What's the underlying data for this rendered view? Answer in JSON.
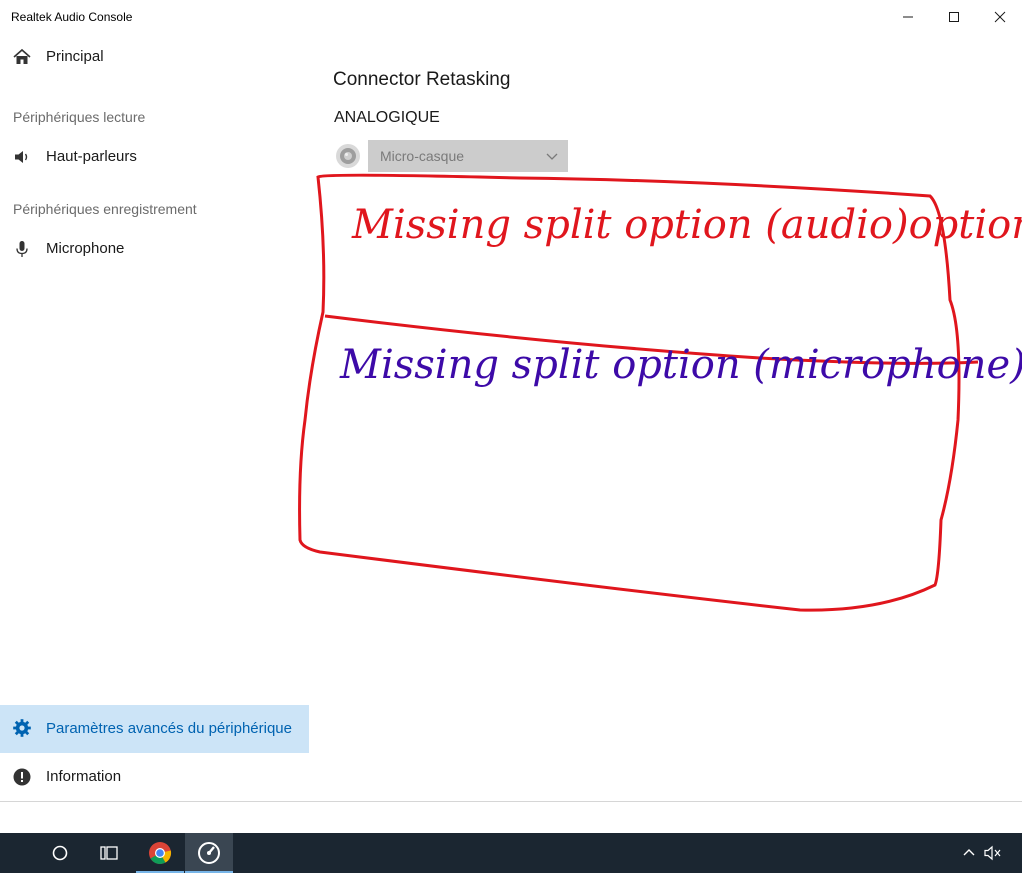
{
  "window": {
    "title": "Realtek Audio Console",
    "controls": [
      "minimize",
      "maximize",
      "close"
    ]
  },
  "sidebar": {
    "main_item": {
      "label": "Principal",
      "icon": "home-icon"
    },
    "playback_header": "Périphériques lecture",
    "playback_items": [
      {
        "label": "Haut-parleurs",
        "icon": "speaker-icon"
      }
    ],
    "recording_header": "Périphériques enregistrement",
    "recording_items": [
      {
        "label": "Microphone",
        "icon": "microphone-icon"
      }
    ],
    "bottom_items": [
      {
        "label": "Paramètres avancés du périphérique",
        "icon": "gear-icon",
        "selected": true
      },
      {
        "label": "Information",
        "icon": "info-icon",
        "selected": false
      }
    ]
  },
  "content": {
    "title": "Connector Retasking",
    "section": "ANALOGIQUE",
    "connector": {
      "icon": "audio-jack-icon",
      "selected_value": "Micro-casque",
      "disabled": true
    }
  },
  "annotations": {
    "box_color": "#e0161d",
    "top_note": "Missing split option (audio)option",
    "top_note_color": "#e0161d",
    "bottom_note": "Missing split option (microphone)",
    "bottom_note_color": "#3d0aa8"
  },
  "taskbar": {
    "items": [
      "search-circle-icon",
      "task-view-icon",
      "chrome-icon",
      "realtek-console-icon"
    ],
    "active_item": "realtek-console-icon",
    "tray": [
      "chevron-up-icon",
      "volume-muted-icon"
    ]
  },
  "colors": {
    "accent": "#0063b1",
    "selected_bg": "#cce4f7",
    "taskbar_bg": "#1b2631"
  }
}
